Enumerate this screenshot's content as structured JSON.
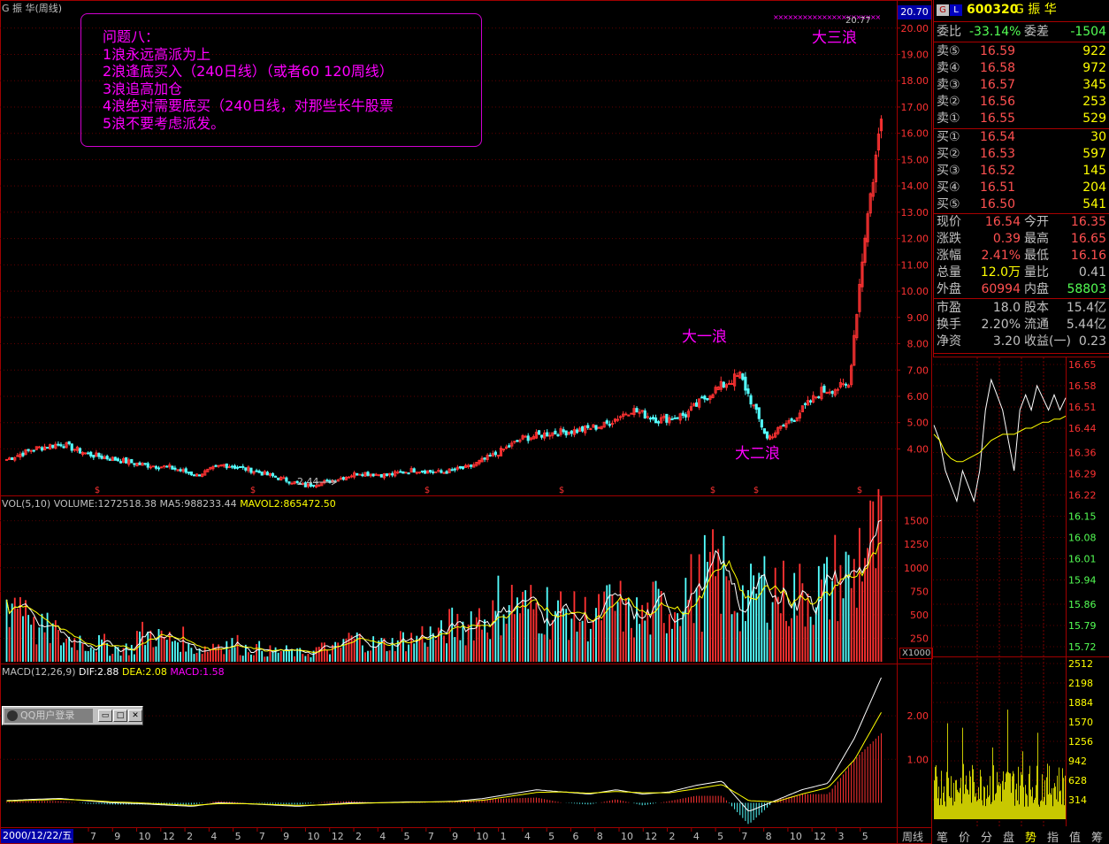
{
  "header": {
    "chart_title": "G 振  华(周线)",
    "price_badge": "20.70"
  },
  "annotation_box": {
    "lines": [
      "问题八：",
      "1浪永远高派为上",
      "2浪逢底买入（240日线）（或者60 120周线）",
      "3浪追高加仓",
      "4浪绝对需要底买（240日线，对那些长牛股票",
      "5浪不要考虑派发。"
    ]
  },
  "wave_labels": {
    "wave1": "大一浪",
    "wave2": "大二浪",
    "wave3": "大三浪",
    "high_marker": "20.77",
    "low_marker": "2.44"
  },
  "volume_header": {
    "name": "VOL(5,10)",
    "volume": "VOLUME:1272518.38",
    "ma5": "MA5:988233.44",
    "mavol2": "MAVOL2:865472.50",
    "unit": "X1000"
  },
  "macd_header": {
    "name": "MACD(12,26,9)",
    "dif": "DIF:2.88",
    "dea": "DEA:2.08",
    "macd": "MACD:1.58"
  },
  "date_axis": {
    "first_date": "2000/12/22/五",
    "ticks": [
      "7",
      "9",
      "10",
      "12",
      "2",
      "4",
      "5",
      "7",
      "9",
      "10",
      "12",
      "2",
      "4",
      "5",
      "7",
      "9",
      "10",
      "1",
      "4",
      "5",
      "6",
      "8",
      "10",
      "12",
      "2",
      "4",
      "5",
      "7",
      "8",
      "10",
      "12",
      "3",
      "5"
    ],
    "period_label": "周线"
  },
  "price_axis": [
    "20.00",
    "19.00",
    "18.00",
    "17.00",
    "16.00",
    "15.00",
    "14.00",
    "13.00",
    "12.00",
    "11.00",
    "10.00",
    "9.00",
    "8.00",
    "7.00",
    "6.00",
    "5.00",
    "4.00"
  ],
  "volume_axis": [
    "1500",
    "1250",
    "1000",
    "750",
    "500",
    "250"
  ],
  "macd_axis": [
    "2.00",
    "1.00"
  ],
  "quote": {
    "code": "600320",
    "name": "G 振  华",
    "weibi_label": "委比",
    "weibi": "-33.14%",
    "weicha_label": "委差",
    "weicha": "-1504",
    "sell": [
      {
        "label": "卖⑤",
        "price": "16.59",
        "vol": "922"
      },
      {
        "label": "卖④",
        "price": "16.58",
        "vol": "972"
      },
      {
        "label": "卖③",
        "price": "16.57",
        "vol": "345"
      },
      {
        "label": "卖②",
        "price": "16.56",
        "vol": "253"
      },
      {
        "label": "卖①",
        "price": "16.55",
        "vol": "529"
      }
    ],
    "buy": [
      {
        "label": "买①",
        "price": "16.54",
        "vol": "30"
      },
      {
        "label": "买②",
        "price": "16.53",
        "vol": "597"
      },
      {
        "label": "买③",
        "price": "16.52",
        "vol": "145"
      },
      {
        "label": "买④",
        "price": "16.51",
        "vol": "204"
      },
      {
        "label": "买⑤",
        "price": "16.50",
        "vol": "541"
      }
    ],
    "stats": [
      {
        "l1": "现价",
        "v1": "16.54",
        "l2": "今开",
        "v2": "16.35"
      },
      {
        "l1": "涨跌",
        "v1": "0.39",
        "l2": "最高",
        "v2": "16.65"
      },
      {
        "l1": "涨幅",
        "v1": "2.41%",
        "l2": "最低",
        "v2": "16.16"
      },
      {
        "l1": "总量",
        "v1": "12.0万",
        "l2": "量比",
        "v2": "0.41"
      },
      {
        "l1": "外盘",
        "v1": "60994",
        "l2": "内盘",
        "v2": "58803"
      }
    ],
    "fund": [
      {
        "l1": "市盈",
        "v1": "18.0",
        "l2": "股本",
        "v2": "15.4亿"
      },
      {
        "l1": "换手",
        "v1": "2.20%",
        "l2": "流通",
        "v2": "5.44亿"
      },
      {
        "l1": "净资",
        "v1": "3.20",
        "l2": "收益(一)",
        "v2": "0.23"
      }
    ]
  },
  "intraday_axis": {
    "price": [
      "16.65",
      "16.58",
      "16.51",
      "16.44",
      "16.36",
      "16.29",
      "16.22",
      "16.15",
      "16.08",
      "16.01",
      "15.94",
      "15.86",
      "15.79",
      "15.72"
    ],
    "volume": [
      "2512",
      "2198",
      "1884",
      "1570",
      "1256",
      "942",
      "628",
      "314"
    ]
  },
  "bottom_tabs": [
    "笔",
    "价",
    "分",
    "盘",
    "势",
    "指",
    "值",
    "筹"
  ],
  "qq_window": {
    "title": "QQ用户登录"
  },
  "colors": {
    "up": "#ff3232",
    "down": "#54ffff",
    "magenta": "#ff00ff",
    "yellow": "#ffff00",
    "axis_red": "#a00000"
  },
  "chart_data": [
    {
      "type": "candlestick",
      "title": "G 振  华(周线)",
      "x": [
        "2000-12",
        "2001-07",
        "2001-09",
        "2001-10",
        "2001-12",
        "2002-02",
        "2002-04",
        "2002-05",
        "2002-07",
        "2002-09",
        "2002-10",
        "2002-12",
        "2003-02",
        "2003-04",
        "2003-05",
        "2003-07",
        "2003-09",
        "2003-10",
        "2004-01",
        "2004-04",
        "2004-05",
        "2004-06",
        "2004-08",
        "2004-10",
        "2004-12",
        "2005-02",
        "2005-04",
        "2005-05",
        "2005-07",
        "2005-08",
        "2005-10",
        "2005-12",
        "2006-03",
        "2006-05"
      ],
      "close": [
        3.6,
        4.0,
        4.2,
        3.8,
        3.6,
        3.4,
        3.3,
        3.0,
        3.4,
        3.2,
        2.9,
        2.6,
        2.8,
        3.1,
        3.0,
        3.2,
        3.1,
        3.3,
        3.8,
        4.4,
        4.6,
        4.7,
        4.9,
        5.5,
        5.1,
        5.3,
        6.2,
        6.8,
        4.4,
        5.2,
        6.2,
        6.4,
        12.2,
        16.54
      ],
      "ylim": [
        2.4,
        20.8
      ],
      "annotations": [
        "大一浪",
        "大二浪",
        "大三浪"
      ]
    },
    {
      "type": "bar",
      "title": "VOL(5,10)",
      "values": [
        700,
        350,
        250,
        200,
        150,
        300,
        250,
        150,
        200,
        150,
        120,
        100,
        150,
        250,
        200,
        250,
        300,
        400,
        500,
        650,
        600,
        550,
        500,
        600,
        500,
        600,
        800,
        950,
        700,
        850,
        750,
        800,
        950,
        1272.5
      ],
      "ylim": [
        0,
        1600
      ]
    },
    {
      "type": "line",
      "title": "MACD(12,26,9)",
      "series": [
        {
          "name": "DIF",
          "values": [
            0.05,
            0.08,
            0.1,
            0.05,
            0.0,
            -0.02,
            -0.05,
            -0.08,
            0.0,
            -0.02,
            -0.05,
            -0.08,
            -0.04,
            0.0,
            0.0,
            0.02,
            0.02,
            0.04,
            0.1,
            0.2,
            0.3,
            0.25,
            0.2,
            0.3,
            0.2,
            0.25,
            0.4,
            0.5,
            -0.2,
            0.05,
            0.3,
            0.45,
            1.5,
            2.88
          ]
        },
        {
          "name": "DEA",
          "values": [
            0.04,
            0.06,
            0.08,
            0.06,
            0.02,
            0.0,
            -0.03,
            -0.06,
            -0.02,
            -0.02,
            -0.04,
            -0.06,
            -0.05,
            -0.02,
            0.0,
            0.01,
            0.02,
            0.03,
            0.06,
            0.15,
            0.24,
            0.25,
            0.22,
            0.26,
            0.23,
            0.23,
            0.32,
            0.42,
            0.05,
            0.02,
            0.2,
            0.35,
            1.0,
            2.08
          ]
        }
      ],
      "ylim": [
        -0.5,
        3.0
      ]
    },
    {
      "type": "line",
      "title": "分时",
      "series": [
        {
          "name": "price",
          "values": [
            16.45,
            16.4,
            16.3,
            16.25,
            16.2,
            16.3,
            16.25,
            16.2,
            16.3,
            16.5,
            16.6,
            16.55,
            16.5,
            16.4,
            16.3,
            16.5,
            16.55,
            16.5,
            16.58,
            16.54,
            16.5,
            16.55,
            16.5,
            16.54
          ]
        },
        {
          "name": "avg",
          "values": [
            16.42,
            16.4,
            16.36,
            16.34,
            16.33,
            16.33,
            16.34,
            16.35,
            16.36,
            16.38,
            16.4,
            16.41,
            16.42,
            16.42,
            16.42,
            16.43,
            16.44,
            16.44,
            16.45,
            16.46,
            16.46,
            16.47,
            16.47,
            16.48
          ]
        }
      ],
      "ylim": [
        15.72,
        16.65
      ]
    }
  ]
}
